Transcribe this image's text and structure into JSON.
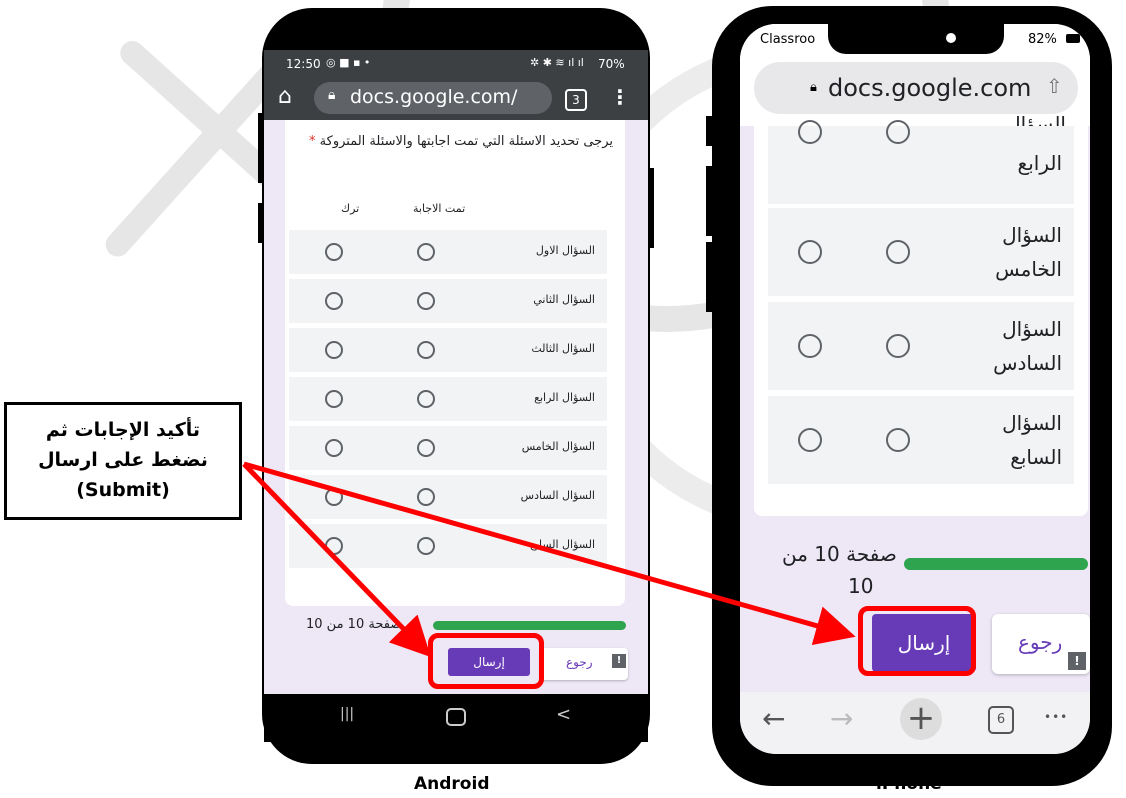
{
  "callout": {
    "line1": "تأكيد الإجابات ثم",
    "line2": "نضغط على ارسال",
    "line3": "(Submit)"
  },
  "android": {
    "label": "Android",
    "status": {
      "time": "12:50",
      "battery": "70%"
    },
    "url": "docs.google.com/",
    "tab_count": "3",
    "question": "يرجى تحديد الاسئلة التي تمت اجابتها والاسئلة المتروكة",
    "required_mark": "*",
    "col_answered": "تمت الاجابة",
    "col_left": "ترك",
    "rows": [
      "السؤال الاول",
      "السؤال الثاني",
      "السؤال الثالث",
      "السؤال الرابع",
      "السؤال الخامس",
      "السؤال السادس",
      "السؤال السابع"
    ],
    "page_info": "صفحة 10 من 10",
    "submit": "إرسال",
    "back": "رجوع",
    "nav": {
      "recent": "|||",
      "home": "O",
      "back": "<"
    }
  },
  "iphone": {
    "label": "iPhone",
    "status": {
      "carrier": "Classroo",
      "battery": "82%"
    },
    "url": "docs.google.com",
    "rows": [
      [
        "الرابع"
      ],
      [
        "السؤال",
        "الخامس"
      ],
      [
        "السؤال",
        "السادس"
      ],
      [
        "السؤال",
        "السابع"
      ]
    ],
    "partial_top": "السؤال",
    "page_info_line1": "صفحة 10 من",
    "page_info_line2": "10",
    "submit": "إرسال",
    "back": "رجوع",
    "tab_count": "6",
    "more": "•••"
  },
  "colors": {
    "accent": "#673ab7",
    "progress": "#2ea44f",
    "highlight": "#ff0000"
  }
}
